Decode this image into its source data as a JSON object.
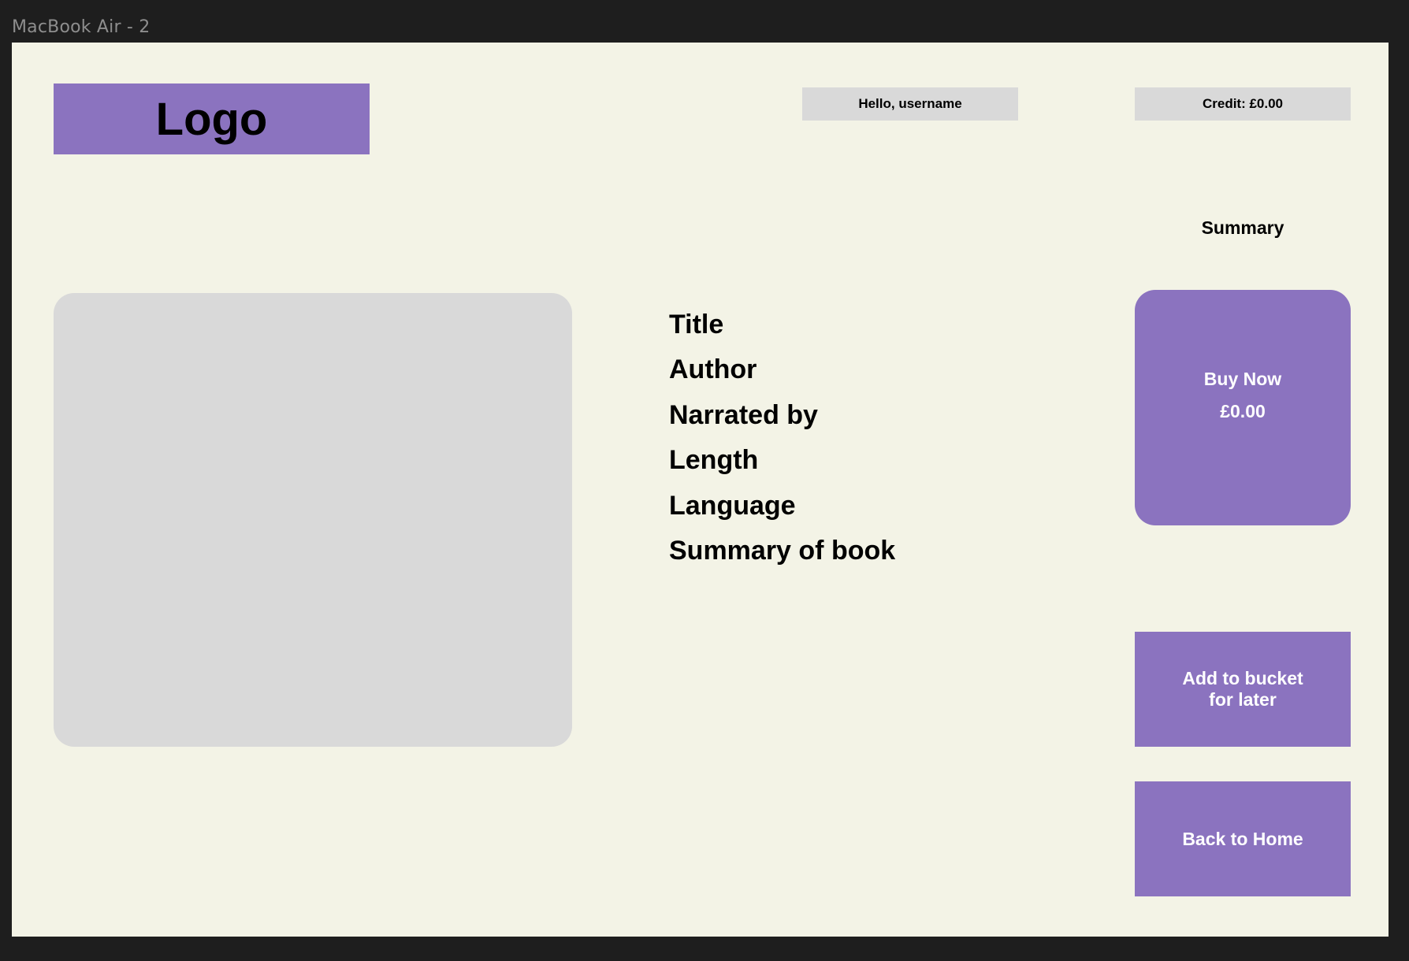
{
  "frame": {
    "label": "MacBook Air - 2"
  },
  "header": {
    "logo_text": "Logo",
    "greeting": "Hello, username",
    "credit": "Credit: £0.00"
  },
  "summary": {
    "heading": "Summary"
  },
  "details": {
    "title": "Title",
    "author": "Author",
    "narrator": "Narrated by",
    "length": "Length",
    "language": "Language",
    "summary": "Summary of book"
  },
  "actions": {
    "buy_label": "Buy Now",
    "buy_price": "£0.00",
    "bucket_line1": "Add to bucket",
    "bucket_line2": "for later",
    "home_label": "Back to Home"
  },
  "colors": {
    "accent": "#8b73bf",
    "placeholder": "#d9d9d9",
    "page_background": "#f3f3e6",
    "app_background": "#1e1e1e"
  }
}
